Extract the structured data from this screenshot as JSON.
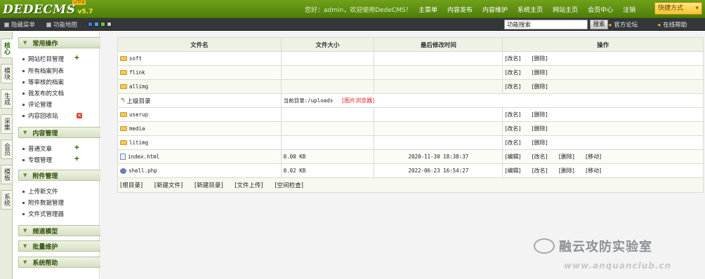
{
  "header": {
    "logo": "DEDECMS",
    "version": "v5.7",
    "badge": "UTF8",
    "welcome": "您好：admin，欢迎使用DedeCMS！",
    "nav": [
      "主菜单",
      "内容发布",
      "内容维护",
      "系统主页",
      "网站主页",
      "会员中心",
      "注销"
    ],
    "quick": "快捷方式"
  },
  "toolbar": {
    "hide_menu": "隐藏菜单",
    "func_map": "功能地图",
    "search_value": "功能搜索",
    "search_btn": "搜索",
    "forum": "官方论坛",
    "help": "在线帮助",
    "colors": [
      "#3b7dd8",
      "#4aa3df",
      "#7ac143",
      "#c9c9c9"
    ]
  },
  "vtabs": [
    "核心",
    "模块",
    "生成",
    "采集",
    "会员",
    "模板",
    "系统"
  ],
  "menu": {
    "sections": [
      {
        "title": "常用操作",
        "items": [
          "网站栏目管理",
          "所有档案列表",
          "等审核的档案",
          "我发布的文档",
          "评论管理",
          "内容回收站"
        ]
      },
      {
        "title": "内容管理",
        "items": [
          "普通文章",
          "专题管理"
        ]
      },
      {
        "title": "附件管理",
        "items": [
          "上传新文件",
          "附件数据管理",
          "文件式管理器"
        ]
      },
      {
        "title": "频道模型",
        "items": []
      },
      {
        "title": "批量维护",
        "items": []
      },
      {
        "title": "系统帮助",
        "items": []
      }
    ]
  },
  "table": {
    "headers": [
      "文件名",
      "文件大小",
      "最后修改时间",
      "操作"
    ],
    "parent_dir": "上级目录",
    "current_dir": "当前目录:/uploads",
    "image_browser": "[图片浏览器]",
    "ops": {
      "rename": "[改名]",
      "delete": "[删除]",
      "edit": "[编辑]",
      "move": "[移动]"
    },
    "rows": [
      {
        "name": "soft",
        "type": "folder"
      },
      {
        "name": "flink",
        "type": "folder"
      },
      {
        "name": "allimg",
        "type": "folder"
      },
      {
        "name": "userup",
        "type": "folder"
      },
      {
        "name": "media",
        "type": "folder"
      },
      {
        "name": "litimg",
        "type": "folder"
      },
      {
        "name": "index.html",
        "type": "html",
        "size": "0.00 KB",
        "time": "2020-11-30 18:38:37"
      },
      {
        "name": "shell.php",
        "type": "php",
        "size": "0.02 KB",
        "time": "2022-06-23 16:54:27"
      }
    ],
    "bottom": [
      "[根目录]",
      "[新建文件]",
      "[新建目录]",
      "[文件上传]",
      "[空间检查]"
    ]
  },
  "watermark": {
    "text": "融云攻防实验室",
    "url": "www.anquanclub.cn"
  }
}
